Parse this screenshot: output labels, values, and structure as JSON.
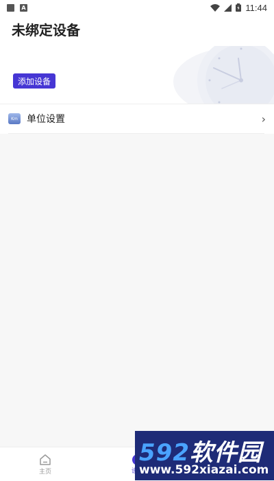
{
  "status_bar": {
    "time": "11:44"
  },
  "header": {
    "title": "未绑定设备",
    "add_button_label": "添加设备"
  },
  "settings": {
    "unit_label": "单位设置",
    "unit_icon_text": "Km"
  },
  "tab_bar": {
    "tabs": [
      {
        "label": "主页",
        "icon": "home-icon"
      },
      {
        "label": "设备",
        "icon": "device-icon"
      }
    ]
  },
  "watermark": {
    "logo_number": "592",
    "logo_text": "软件园",
    "url": "www.592xiazai.com"
  },
  "colors": {
    "accent": "#4636d4",
    "content_bg": "#f7f7f7",
    "watermark_bg": "#1e2b77"
  }
}
